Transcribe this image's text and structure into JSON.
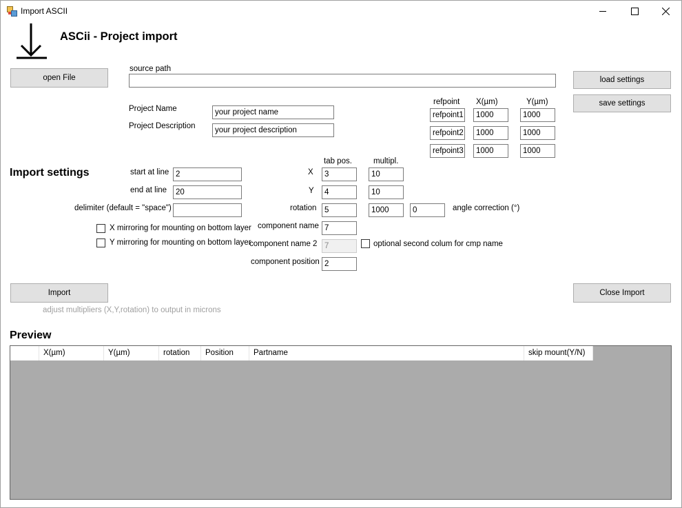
{
  "window": {
    "title": "Import ASCII",
    "heading": "ASCii - Project import"
  },
  "buttons": {
    "open_file": "open File",
    "load_settings": "load settings",
    "save_settings": "save settings",
    "import": "Import",
    "close_import": "Close Import"
  },
  "source": {
    "label": "source path",
    "value": ""
  },
  "project": {
    "name_label": "Project Name",
    "name_value": "your project name",
    "description_label": "Project Description",
    "description_value": "your project description"
  },
  "refpoints": {
    "header_refpoint": "refpoint",
    "header_x": "X(µm)",
    "header_y": "Y(µm)",
    "rows": [
      {
        "name": "refpoint1",
        "x": "1000",
        "y": "1000"
      },
      {
        "name": "refpoint2",
        "x": "1000",
        "y": "1000"
      },
      {
        "name": "refpoint3",
        "x": "1000",
        "y": "1000"
      }
    ]
  },
  "import_settings": {
    "heading": "Import settings",
    "start_label": "start at line",
    "start_value": "2",
    "end_label": "end at line",
    "end_value": "20",
    "delimiter_label": "delimiter (default = \"space\")",
    "delimiter_value": "",
    "x_mirror_label": "X mirroring for mounting on bottom layer",
    "y_mirror_label": "Y mirroring for mounting on bottom layer"
  },
  "tabs": {
    "header_tab": "tab pos.",
    "header_mult": "multipl.",
    "x_label": "X",
    "x_tab": "3",
    "x_mult": "10",
    "y_label": "Y",
    "y_tab": "4",
    "y_mult": "10",
    "rotation_label": "rotation",
    "rotation_tab": "5",
    "rotation_mult": "1000",
    "angle_value": "0",
    "angle_label": "angle correction (°)",
    "cmp_name_label": "component name",
    "cmp_name_tab": "7",
    "cmp_name2_label": "component name 2",
    "cmp_name2_tab": "7",
    "cmp_name2_option": "optional second colum for cmp name",
    "cmp_pos_label": "component position",
    "cmp_pos_tab": "2"
  },
  "hint": "adjust multipliers (X,Y,rotation) to output in microns",
  "preview": {
    "heading": "Preview",
    "columns": [
      "X(µm)",
      "Y(µm)",
      "rotation",
      "Position",
      "Partname",
      "skip mount(Y/N)"
    ]
  },
  "colors": {
    "button_bg": "#e1e1e1",
    "grid_bg": "#ababab",
    "hint_text": "#a0a0a0"
  }
}
